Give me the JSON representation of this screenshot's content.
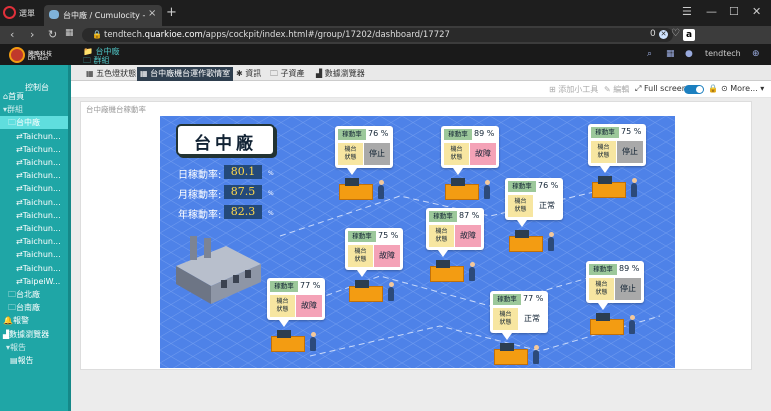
{
  "browser": {
    "menu_label": "選單",
    "tab_title": "台中廠 / Cumulocity - Co",
    "tab_close": "×",
    "new_tab": "+",
    "url_prefix": "tendtech.",
    "url_domain": "quarkioe.com",
    "url_path": "/apps/cockpit/index.html#/group/17202/dashboard/17727",
    "zero": "0",
    "amazon": "a"
  },
  "app_header": {
    "breadcrumb_group": "台中廠",
    "breadcrumb_parent": "群組",
    "user": "tendtech"
  },
  "sidebar": {
    "logo_line1": "騰略科技",
    "logo_line2": "DH Tech",
    "title": "控制台",
    "items": [
      {
        "label": "首頁",
        "icon": "home-icon"
      },
      {
        "label": "群組",
        "icon": "caret-icon"
      },
      {
        "label": "台中廠",
        "icon": "folder-icon"
      },
      {
        "label": "Taichun...",
        "icon": "device-icon"
      },
      {
        "label": "Taichun...",
        "icon": "device-icon"
      },
      {
        "label": "Taichun...",
        "icon": "device-icon"
      },
      {
        "label": "Taichun...",
        "icon": "device-icon"
      },
      {
        "label": "Taichun...",
        "icon": "device-icon"
      },
      {
        "label": "Taichun...",
        "icon": "device-icon"
      },
      {
        "label": "Taichun...",
        "icon": "device-icon"
      },
      {
        "label": "Taichun...",
        "icon": "device-icon"
      },
      {
        "label": "Taichun...",
        "icon": "device-icon"
      },
      {
        "label": "Taichun...",
        "icon": "device-icon"
      },
      {
        "label": "Taichun...",
        "icon": "device-icon"
      },
      {
        "label": "TaipeiW...",
        "icon": "device-icon"
      },
      {
        "label": "台北廠",
        "icon": "folder-icon"
      },
      {
        "label": "台南廠",
        "icon": "folder-icon"
      },
      {
        "label": "報警",
        "icon": "bell-icon"
      },
      {
        "label": "數據瀏覽器",
        "icon": "chart-icon"
      },
      {
        "label": "報告",
        "icon": "caret-icon"
      },
      {
        "label": "報告",
        "icon": "report-icon"
      }
    ]
  },
  "tabs": [
    {
      "label": "五色燈狀態",
      "icon": "grid-icon"
    },
    {
      "label": "台中廠機台運作歌情室",
      "icon": "grid-icon"
    },
    {
      "label": "資訊",
      "icon": "gear-icon"
    },
    {
      "label": "子資產",
      "icon": "folder-icon"
    },
    {
      "label": "數據瀏覽器",
      "icon": "chart-icon"
    }
  ],
  "toolbar": {
    "add_widget": "添加小工具",
    "edit": "編輯",
    "fullscreen": "Full screen",
    "more": "More..."
  },
  "panel": {
    "title": "台中廠機台稼動率"
  },
  "scene": {
    "plant_name": "台中廠",
    "rates": [
      {
        "label": "日稼動率:",
        "value": "80.1",
        "unit": "%"
      },
      {
        "label": "月稼動率:",
        "value": "87.5",
        "unit": "%"
      },
      {
        "label": "年稼動率:",
        "value": "82.3",
        "unit": "%"
      }
    ],
    "card_header": "稼動率",
    "card_status_label": "機台\n狀態",
    "machines": [
      {
        "pct": "76",
        "status": "停止",
        "kind": "stop"
      },
      {
        "pct": "89",
        "status": "故障",
        "kind": "fault"
      },
      {
        "pct": "75",
        "status": "停止",
        "kind": "stop"
      },
      {
        "pct": "76",
        "status": "正常",
        "kind": "normal"
      },
      {
        "pct": "87",
        "status": "故障",
        "kind": "fault"
      },
      {
        "pct": "75",
        "status": "故障",
        "kind": "fault"
      },
      {
        "pct": "89",
        "status": "停止",
        "kind": "stop"
      },
      {
        "pct": "77",
        "status": "故障",
        "kind": "fault"
      },
      {
        "pct": "77",
        "status": "正常",
        "kind": "normal"
      }
    ],
    "pct_unit": "%"
  },
  "colors": {
    "sidebar": "#1fa6a6",
    "sidebar_selected": "#5fdede",
    "scene_bg": "#4e82e8",
    "active_tab": "#2e3e4e",
    "stop": "#a9a9a9",
    "fault": "#f4a2b7",
    "normal": "#ffffff"
  }
}
